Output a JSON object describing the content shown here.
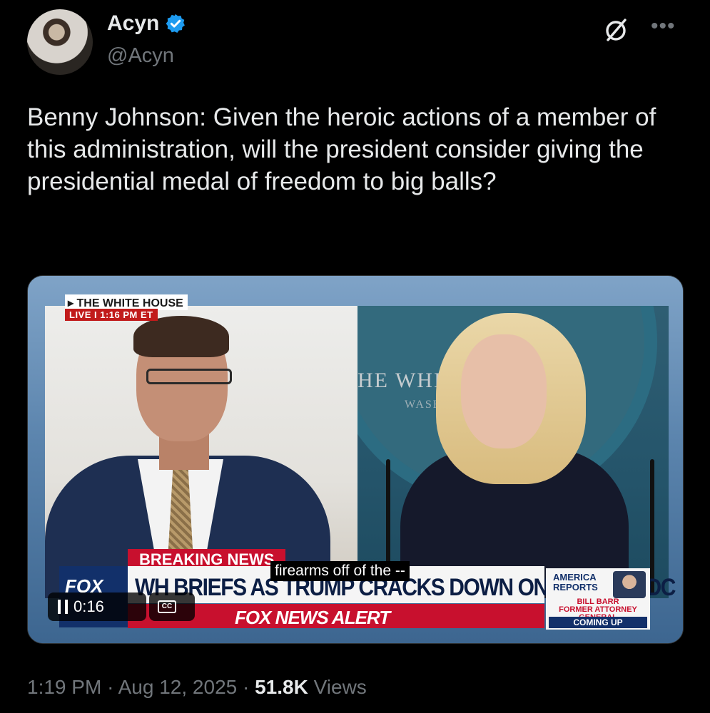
{
  "author": {
    "display_name": "Acyn",
    "handle": "@Acyn",
    "verified_color": "#1d9bf0"
  },
  "tweet": {
    "text": "Benny Johnson: Given the heroic actions of a member of this administration, will the president consider giving the presidential medal of freedom to big balls?"
  },
  "video": {
    "location_label": "THE WHITE HOUSE",
    "live_label": "LIVE",
    "live_time": "1:16 PM ET",
    "breaking_label": "BREAKING NEWS",
    "headline": "WH BRIEFS AS TRUMP CRACKS DOWN ON CRIME IN DC",
    "alert_label": "FOX NEWS ALERT",
    "network_logo": "FOX",
    "backdrop_text": "HE WHIT      SE",
    "backdrop_sub": "WASH",
    "caption": "firearms off of the --",
    "elapsed": "0:16",
    "cc_label": "CC",
    "promo": {
      "show": "AMERICA REPORTS",
      "guest_name": "BILL BARR",
      "guest_title": "FORMER ATTORNEY GENERAL",
      "coming": "COMING UP"
    }
  },
  "meta": {
    "time": "1:19 PM",
    "date": "Aug 12, 2025",
    "views_count": "51.8K",
    "views_label": "Views",
    "separator": "·"
  },
  "icons": {
    "verified": "verified-badge-icon",
    "grok": "grok-icon",
    "more": "more-icon",
    "pause": "pause-icon",
    "cc": "cc-icon"
  },
  "colors": {
    "background": "#000000",
    "text_primary": "#e7e9ea",
    "text_secondary": "#71767b",
    "fox_red": "#c8102e",
    "fox_blue": "#12306a"
  }
}
